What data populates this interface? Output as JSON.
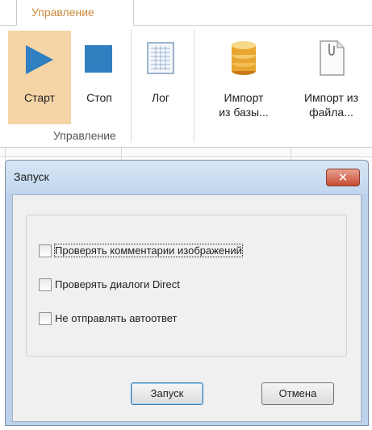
{
  "ribbon": {
    "tab_label": "Управление",
    "group_label": "Управление",
    "buttons": {
      "start": "Старт",
      "stop": "Стоп",
      "log": "Лог",
      "import_db_line1": "Импорт",
      "import_db_line2": "из базы...",
      "import_file_line1": "Импорт из",
      "import_file_line2": "файла..."
    }
  },
  "dialog": {
    "title": "Запуск",
    "close_symbol": "✕",
    "options": [
      {
        "label": "Проверять комментарии изображений",
        "checked": false
      },
      {
        "label": "Проверять диалоги Direct",
        "checked": false
      },
      {
        "label": "Не отправлять автоответ",
        "checked": false
      }
    ],
    "ok_label": "Запуск",
    "cancel_label": "Отмена"
  },
  "colors": {
    "accent_active": "#f5d4a6",
    "play_icon": "#2f7fc1",
    "tab_text": "#c98a3a"
  }
}
